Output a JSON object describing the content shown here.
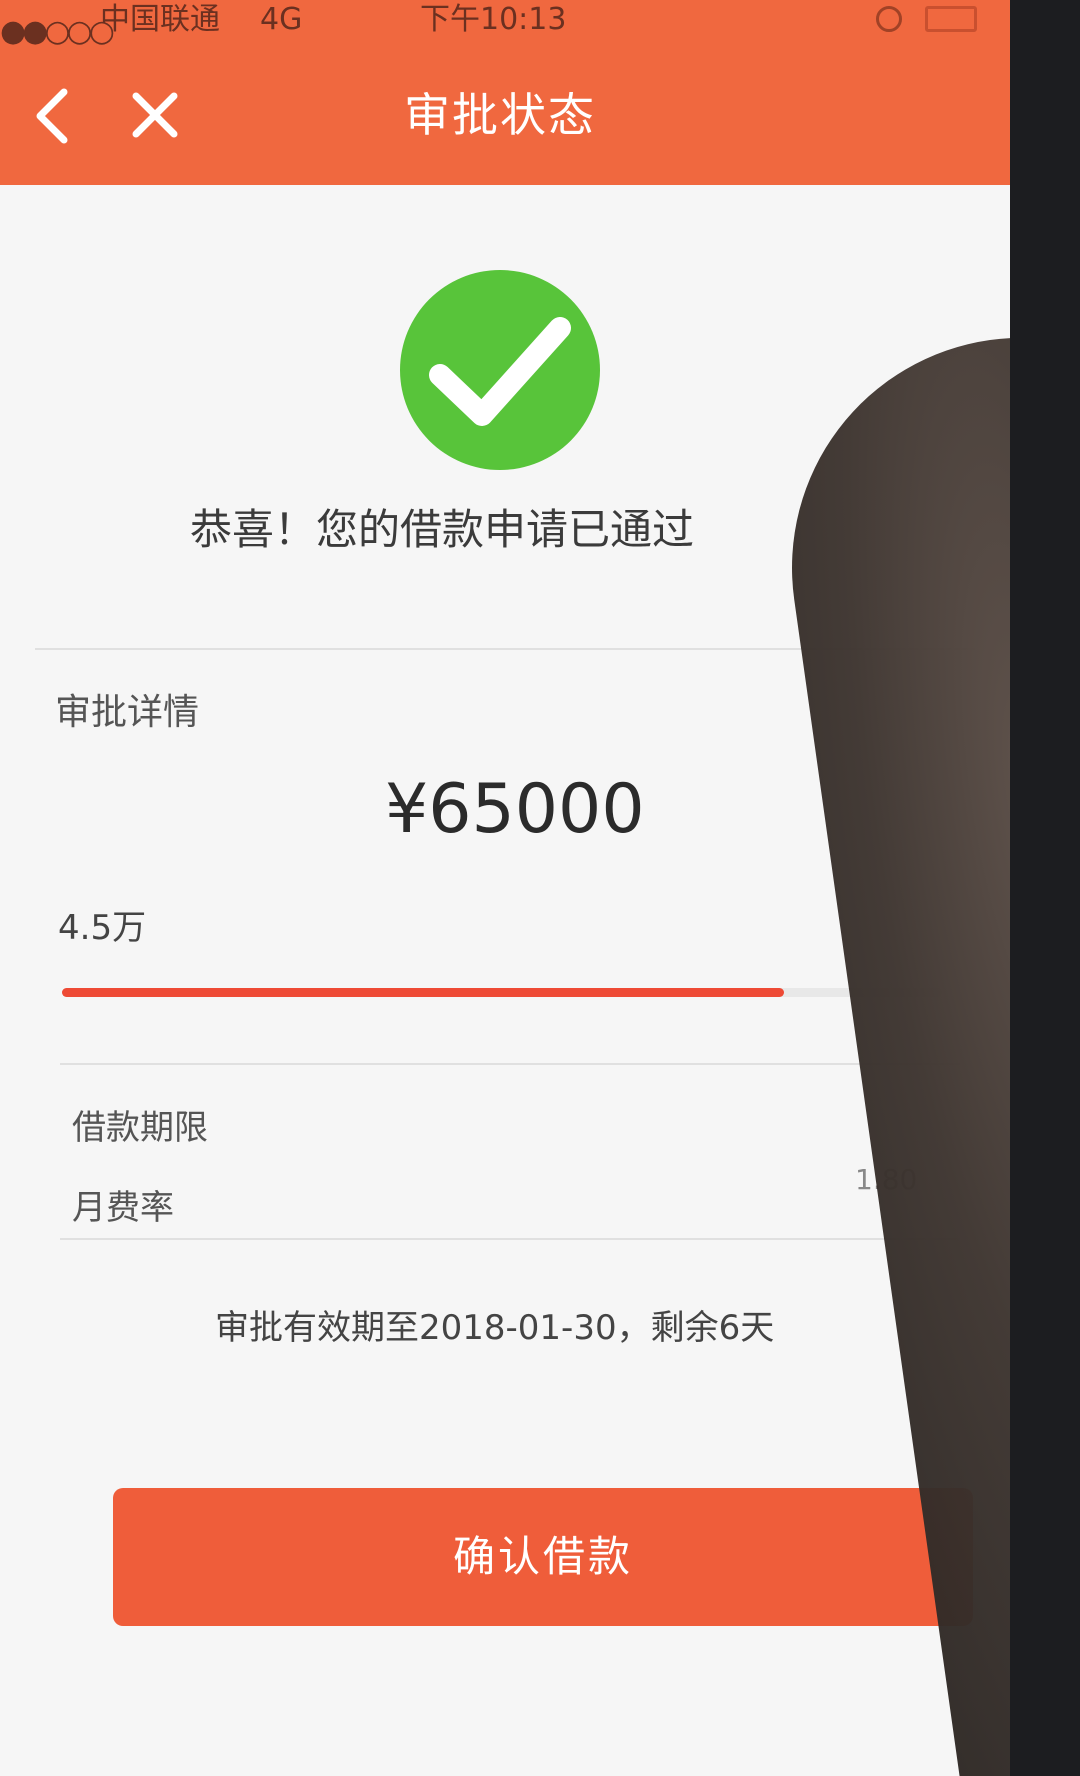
{
  "status_bar": {
    "signal": "●●○○○",
    "carrier": "中国联通",
    "network": "4G",
    "time": "下午10:13"
  },
  "nav": {
    "back_icon": "chevron-left-icon",
    "close_icon": "close-icon",
    "title": "审批状态"
  },
  "result": {
    "icon": "check-circle-icon",
    "icon_color": "#58c43a",
    "message": "恭喜！您的借款申请已通过"
  },
  "details": {
    "section_title": "审批详情",
    "amount": "¥65000",
    "slider_min_label": "4.5万",
    "slider_fill_fraction": 0.82,
    "term_label": "借款期限",
    "fee_rate_label": "月费率",
    "fee_rate_value": "1.80"
  },
  "validity": "审批有效期至2018-01-30，剩余6天",
  "confirm_button": "确认借款",
  "colors": {
    "brand": "#f0683f",
    "button": "#ef5d3a",
    "slider": "#ee4a35"
  }
}
